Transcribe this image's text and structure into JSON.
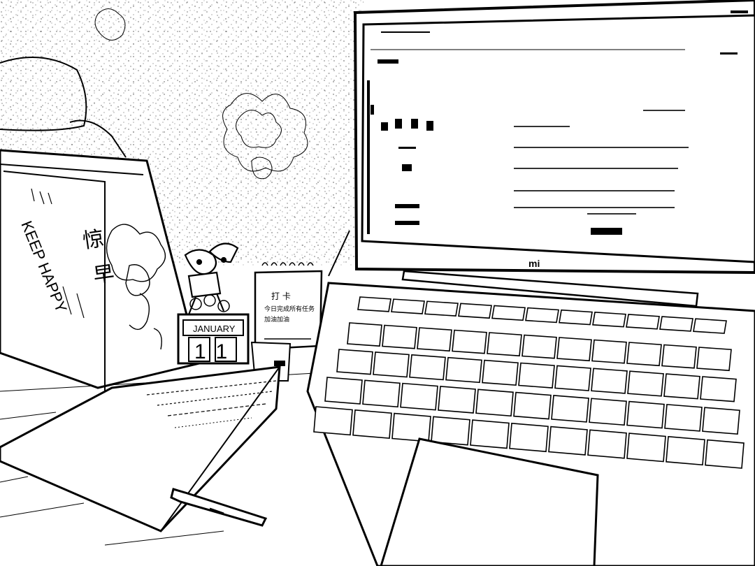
{
  "photo": {
    "book_spine_text": "KEEP HAPPY",
    "book_cover_title": "惊",
    "book_cover_title_2": "早",
    "calendar_month": "JANUARY",
    "calendar_day": "11",
    "notepad_line_1": "打 卡",
    "notepad_line_2": "今日完成所有任务",
    "notepad_line_3": "加油加油",
    "laptop_logo": "mi"
  },
  "colors": {
    "ink": "#000000",
    "paper": "#ffffff"
  }
}
